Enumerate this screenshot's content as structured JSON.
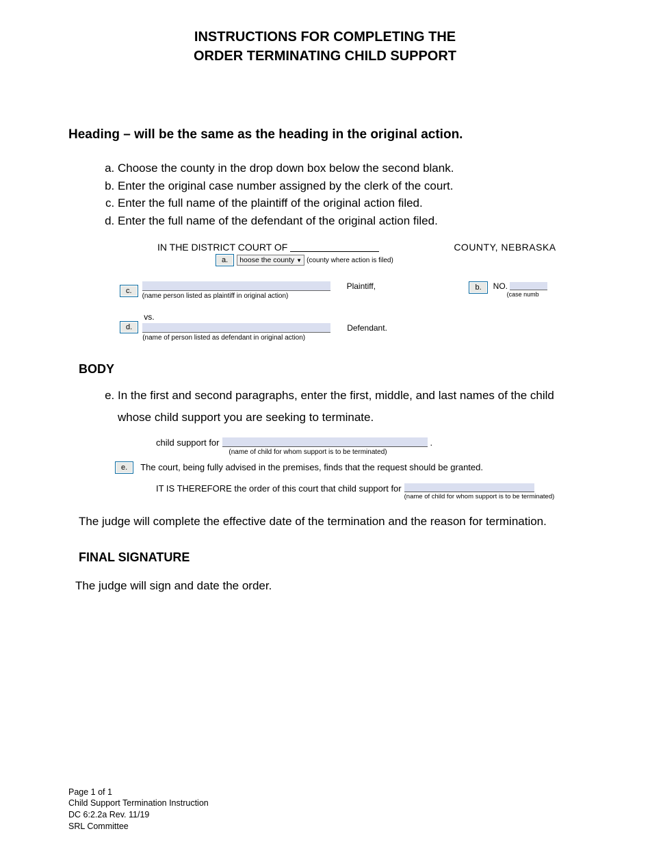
{
  "title": {
    "line1": "INSTRUCTIONS FOR COMPLETING THE",
    "line2": "ORDER TERMINATING CHILD SUPPORT"
  },
  "heading_section": {
    "title": "Heading – will be the same as the heading in the original action.",
    "items": {
      "a": "Choose the county in the drop down box below the second blank.",
      "b": "Enter the original case number assigned by the clerk of the court.",
      "c": "Enter the full name of the plaintiff of the original action filed.",
      "d": "Enter the full name of the defendant of the original action filed."
    }
  },
  "form1": {
    "court_prefix": "IN THE  DISTRICT COURT OF",
    "county_caption": "(county where action is filed)",
    "county_suffix": "COUNTY, NEBRASKA",
    "dropdown_label": "hoose the county",
    "callout_a": "a.",
    "callout_b": "b.",
    "callout_c": "c.",
    "callout_d": "d.",
    "no_label": "NO.",
    "no_caption": "(case numb",
    "plaintiff_caption": "(name person listed as plaintiff in original action)",
    "plaintiff_role": "Plaintiff,",
    "vs": "vs.",
    "defendant_caption": "(name of person listed as defendant in original action)",
    "defendant_role": "Defendant."
  },
  "body_section": {
    "title": "BODY",
    "item_e": "In the first and second paragraphs, enter the first, middle, and last names of the child whose child support you are seeking to terminate.",
    "note": "The judge will complete the effective date of the termination and the reason for termination."
  },
  "form2": {
    "line1_prefix": "child support for",
    "line1_caption": "(name of child for whom support is to be terminated)",
    "callout_e": "e.",
    "line2": "The court, being fully advised in the premises, finds that the request should be granted.",
    "line3_prefix": "IT IS THEREFORE the order of this court that child support for",
    "line3_caption": "(name of child for whom support is to be terminated)"
  },
  "final_sig": {
    "title": "FINAL SIGNATURE",
    "text": "The judge will sign and date the order."
  },
  "footer": {
    "l1": "Page 1 of 1",
    "l2": "Child Support Termination Instruction",
    "l3": "DC 6:2.2a Rev. 11/19",
    "l4": "SRL Committee"
  }
}
